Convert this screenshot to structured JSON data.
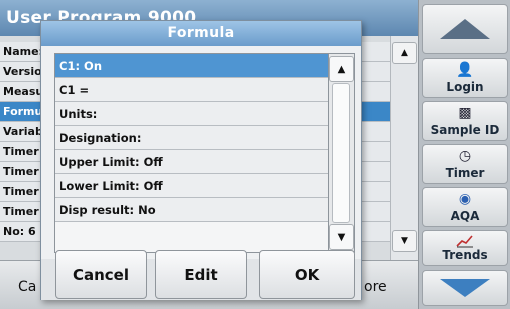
{
  "background": {
    "title": "User Program   9000",
    "rows": [
      "Name:",
      "Version",
      "Measure",
      "Formula",
      "Variable",
      "Timer 1",
      "Timer 2",
      "Timer 3",
      "Timer 4",
      "No: 6"
    ],
    "selected_index": 3,
    "bottom_left": "Ca",
    "bottom_right": "ore"
  },
  "sidebar": {
    "login": "Login",
    "sample_id": "Sample ID",
    "timer": "Timer",
    "aqa": "AQA",
    "trends": "Trends"
  },
  "dialog": {
    "title": "Formula",
    "items": [
      "C1: On",
      "C1 =",
      "Units:",
      "Designation:",
      "Upper Limit: Off",
      "Lower Limit: Off",
      "Disp result: No"
    ],
    "selected_index": 0,
    "cancel": "Cancel",
    "edit": "Edit",
    "ok": "OK"
  },
  "colors": {
    "selection": "#4f95d2",
    "title_bar": "#6b9ccb"
  }
}
